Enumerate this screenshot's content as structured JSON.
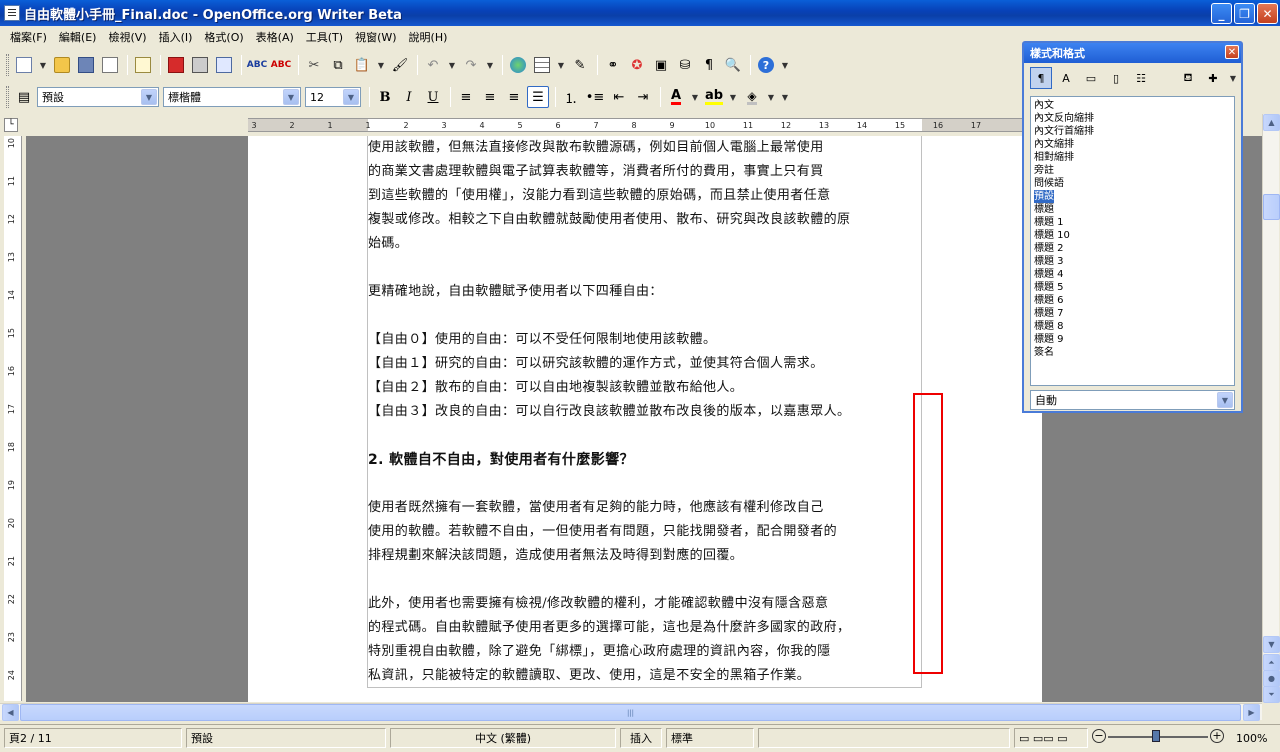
{
  "window": {
    "title": "自由軟體小手冊_Final.doc - OpenOffice.org Writer Beta"
  },
  "menu": [
    "檔案(F)",
    "編輯(E)",
    "檢視(V)",
    "插入(I)",
    "格式(O)",
    "表格(A)",
    "工具(T)",
    "視窗(W)",
    "說明(H)"
  ],
  "format_toolbar": {
    "paragraph_style": "預設",
    "font_name": "標楷體",
    "font_size": "12"
  },
  "ruler": {
    "h_ticks": [
      "3",
      "2",
      "1",
      "1",
      "2",
      "3",
      "4",
      "5",
      "6",
      "7",
      "8",
      "9",
      "10",
      "11",
      "12",
      "13",
      "14",
      "15",
      "16",
      "17"
    ],
    "v_ticks": [
      "10",
      "11",
      "12",
      "13",
      "14",
      "15",
      "16",
      "17",
      "18",
      "19",
      "20",
      "21",
      "22",
      "23",
      "24"
    ]
  },
  "document": {
    "paragraphs": [
      {
        "text": "使用該軟體，但無法直接修改與散布軟體源碼，例如目前個人電腦上最常使用",
        "kind": "body"
      },
      {
        "text": "的商業文書處理軟體與電子試算表軟體等，消費者所付的費用，事實上只有買",
        "kind": "body"
      },
      {
        "text": "到這些軟體的「使用權」，沒能力看到這些軟體的原始碼，而且禁止使用者任意",
        "kind": "body"
      },
      {
        "text": "複製或修改。相較之下自由軟體就鼓勵使用者使用、散布、研究與改良該軟體的原",
        "kind": "body"
      },
      {
        "text": "始碼。",
        "kind": "body"
      },
      {
        "text": "",
        "kind": "gap"
      },
      {
        "text": "更精確地說，自由軟體賦予使用者以下四種自由：",
        "kind": "body"
      },
      {
        "text": "",
        "kind": "gap"
      },
      {
        "text": "【自由０】使用的自由：可以不受任何限制地使用該軟體。",
        "kind": "body"
      },
      {
        "text": "【自由１】研究的自由：可以研究該軟體的運作方式，並使其符合個人需求。",
        "kind": "body"
      },
      {
        "text": "【自由２】散布的自由：可以自由地複製該軟體並散布給他人。",
        "kind": "body"
      },
      {
        "text": "【自由３】改良的自由：可以自行改良該軟體並散布改良後的版本，以嘉惠眾人。",
        "kind": "body"
      },
      {
        "text": "",
        "kind": "gap"
      },
      {
        "text": "2. 軟體自不自由，對使用者有什麼影響？",
        "kind": "heading"
      },
      {
        "text": "",
        "kind": "gap"
      },
      {
        "text": "使用者既然擁有一套軟體，當使用者有足夠的能力時，他應該有權利修改自己",
        "kind": "body"
      },
      {
        "text": "使用的軟體。若軟體不自由，一但使用者有問題，只能找開發者，配合開發者的",
        "kind": "body"
      },
      {
        "text": "排程規劃來解決該問題，造成使用者無法及時得到對應的回覆。",
        "kind": "body"
      },
      {
        "text": "",
        "kind": "gap"
      },
      {
        "text": "此外，使用者也需要擁有檢視/修改軟體的權利，才能確認軟體中沒有隱含惡意",
        "kind": "body"
      },
      {
        "text": "的程式碼。自由軟體賦予使用者更多的選擇可能，這也是為什麼許多國家的政府，",
        "kind": "body"
      },
      {
        "text": "特別重視自由軟體，除了避免「綁標」，更擔心政府處理的資訊內容，你我的隱",
        "kind": "body"
      },
      {
        "text": "私資訊，只能被特定的軟體讀取、更改、使用，這是不安全的黑箱子作業。",
        "kind": "body"
      }
    ]
  },
  "stylist": {
    "title": "樣式和格式",
    "styles": [
      "內文",
      "內文反向縮排",
      "內文行首縮排",
      "內文縮排",
      "相對縮排",
      "旁註",
      "問候語",
      "預設",
      "標題",
      "標題 1",
      "標題 10",
      "標題 2",
      "標題 3",
      "標題 4",
      "標題 5",
      "標題 6",
      "標題 7",
      "標題 8",
      "標題 9",
      "簽名"
    ],
    "selected_index": 7,
    "filter": "自動"
  },
  "status": {
    "page": "頁2 / 11",
    "page_style": "預設",
    "language": "中文 (繁體)",
    "insert_mode": "插入",
    "selection_mode": "標準",
    "zoom": "100%"
  },
  "colors": {
    "title_bar": "#0842b8",
    "annotation_box": "#ee0000",
    "font_color": "#ff0000",
    "highlight": "#ffff00"
  }
}
